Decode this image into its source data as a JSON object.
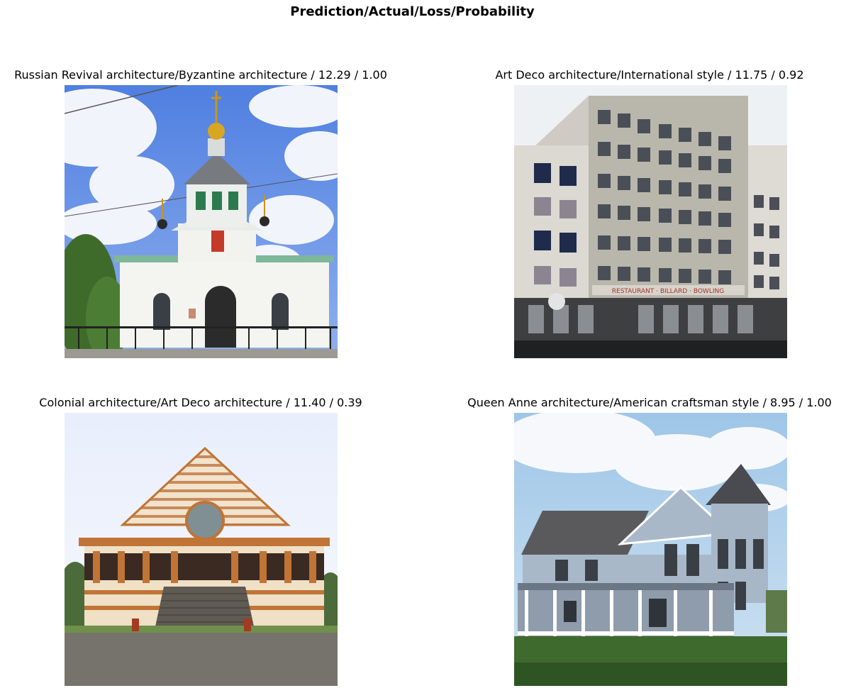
{
  "suptitle": "Prediction/Actual/Loss/Probability",
  "panels": [
    {
      "title": "Russian Revival architecture/Byzantine architecture / 12.29 / 1.00"
    },
    {
      "title": "Art Deco architecture/International style / 11.75 / 0.92"
    },
    {
      "title": "Colonial architecture/Art Deco architecture / 11.40 / 0.39"
    },
    {
      "title": "Queen Anne architecture/American craftsman style / 8.95 / 1.00"
    }
  ],
  "photos": {
    "p2_sign": "RESTAURANT · BILLARD · BOWLING"
  }
}
